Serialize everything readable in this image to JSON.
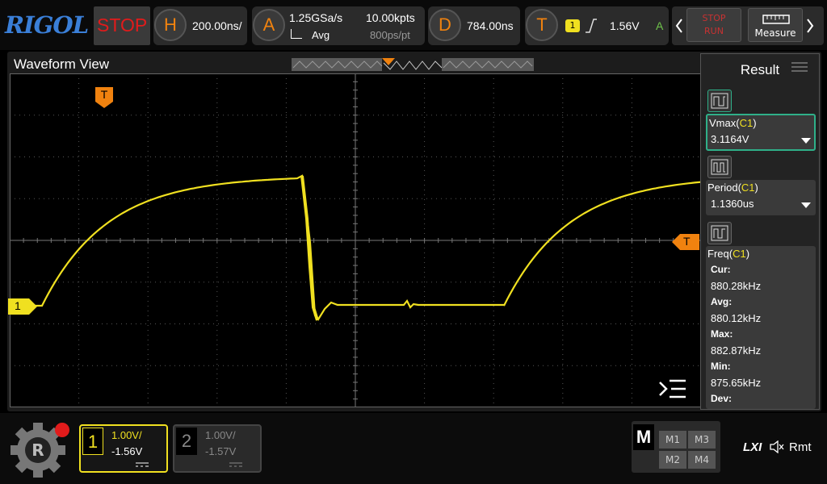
{
  "brand": "RIGOL",
  "run_state": "STOP",
  "horizontal": {
    "key": "H",
    "timebase": "200.00ns/"
  },
  "acquire": {
    "key": "A",
    "sample_rate": "1.25GSa/s",
    "mode": "Avg",
    "memory_depth": "10.00kpts",
    "sample_interval": "800ps/pt"
  },
  "delay": {
    "key": "D",
    "value": "784.00ns"
  },
  "trigger": {
    "key": "T",
    "source": "1",
    "level": "1.56V",
    "mode": "A"
  },
  "stop_run": {
    "stop": "STOP",
    "run": "RUN"
  },
  "measure_label": "Measure",
  "waveform_title": "Waveform View",
  "trigger_marker": "T",
  "channel1_marker": "1",
  "result_panel": {
    "title": "Result",
    "items": [
      {
        "name": "Vmax",
        "source": "C1",
        "value": "3.1164V"
      },
      {
        "name": "Period",
        "source": "C1",
        "value": "1.1360us"
      },
      {
        "name": "Freq",
        "source": "C1",
        "stats": [
          {
            "label": "Cur:",
            "value": "880.28kHz"
          },
          {
            "label": "Avg:",
            "value": "880.12kHz"
          },
          {
            "label": "Max:",
            "value": "882.87kHz"
          },
          {
            "label": "Min:",
            "value": "875.65kHz"
          },
          {
            "label": "Dev:",
            "value": ""
          }
        ]
      }
    ]
  },
  "channels": [
    {
      "num": "1",
      "scale": "1.00V/",
      "offset": "-1.56V",
      "active": true
    },
    {
      "num": "2",
      "scale": "1.00V/",
      "offset": "-1.57V",
      "active": false
    }
  ],
  "math": {
    "label": "M",
    "items": [
      "M1",
      "M3",
      "M2",
      "M4"
    ]
  },
  "status": {
    "lxi": "LXI",
    "remote": "Rmt"
  },
  "colors": {
    "ch1": "#f0e020",
    "accent": "#f0820f",
    "stop": "#e11b1b",
    "brand": "#3a7fd8"
  }
}
